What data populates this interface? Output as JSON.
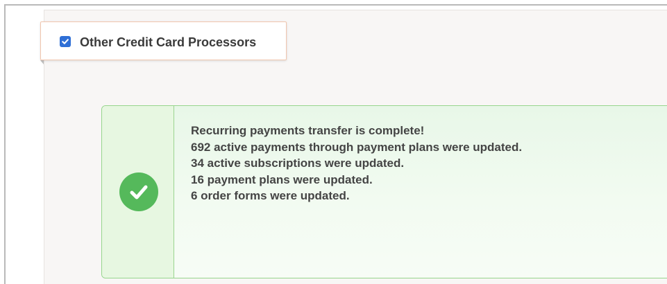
{
  "checkbox_card": {
    "label": "Other Credit Card Processors",
    "checked": true,
    "accent": "#2f6fd6",
    "border": "#f1c6ae"
  },
  "alert": {
    "type": "success",
    "icon": "check-circle-icon",
    "accent": "#55b95b",
    "background": "#e9f8e7",
    "lines": [
      "Recurring payments transfer is complete!",
      "692 active payments through payment plans were updated.",
      "34 active subscriptions were updated.",
      "16 payment plans were updated.",
      "6 order forms were updated."
    ]
  }
}
